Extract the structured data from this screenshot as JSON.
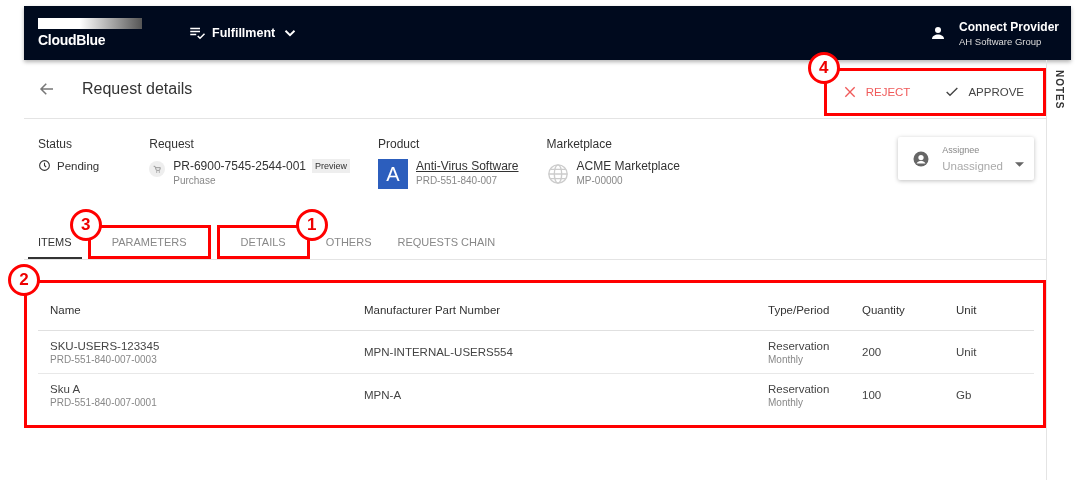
{
  "header": {
    "logo": "CloudBlue",
    "module": "Fulfillment",
    "user": {
      "name": "Connect Provider",
      "company": "AH Software Group"
    }
  },
  "page": {
    "title": "Request details",
    "actions": [
      {
        "kind": "reject",
        "label": "REJECT"
      },
      {
        "kind": "approve",
        "label": "APPROVE"
      }
    ],
    "actions_callout": "4"
  },
  "info": {
    "status": {
      "label": "Status",
      "value": "Pending"
    },
    "request": {
      "label": "Request",
      "id": "PR-6900-7545-2544-001",
      "badge": "Preview",
      "type": "Purchase"
    },
    "product": {
      "label": "Product",
      "initial": "A",
      "name": "Anti-Virus Software",
      "id": "PRD-551-840-007"
    },
    "marketplace": {
      "label": "Marketplace",
      "name": "ACME Marketplace",
      "id": "MP-00000"
    },
    "assignee": {
      "label": "Assignee",
      "placeholder": "Unassigned"
    }
  },
  "tabs": [
    {
      "label": "ITEMS",
      "selected": true
    },
    {
      "label": "PARAMETERS",
      "selected": false,
      "callout": "3"
    },
    {
      "label": "DETAILS",
      "selected": false,
      "callout": "1"
    },
    {
      "label": "OTHERS",
      "selected": false
    },
    {
      "label": "REQUESTS CHAIN",
      "selected": false
    }
  ],
  "table": {
    "callout": "2",
    "columns": [
      "Name",
      "Manufacturer Part Number",
      "Type/Period",
      "Quantity",
      "Unit"
    ],
    "rows": [
      {
        "name": "SKU-USERS-123345",
        "id": "PRD-551-840-007-0003",
        "mpn": "MPN-INTERNAL-USERS554",
        "type": "Reservation",
        "period": "Monthly",
        "quantity": "200",
        "unit": "Unit"
      },
      {
        "name": "Sku A",
        "id": "PRD-551-840-007-0001",
        "mpn": "MPN-A",
        "type": "Reservation",
        "period": "Monthly",
        "quantity": "100",
        "unit": "Gb"
      }
    ]
  },
  "notes_panel": {
    "label": "NOTES"
  }
}
